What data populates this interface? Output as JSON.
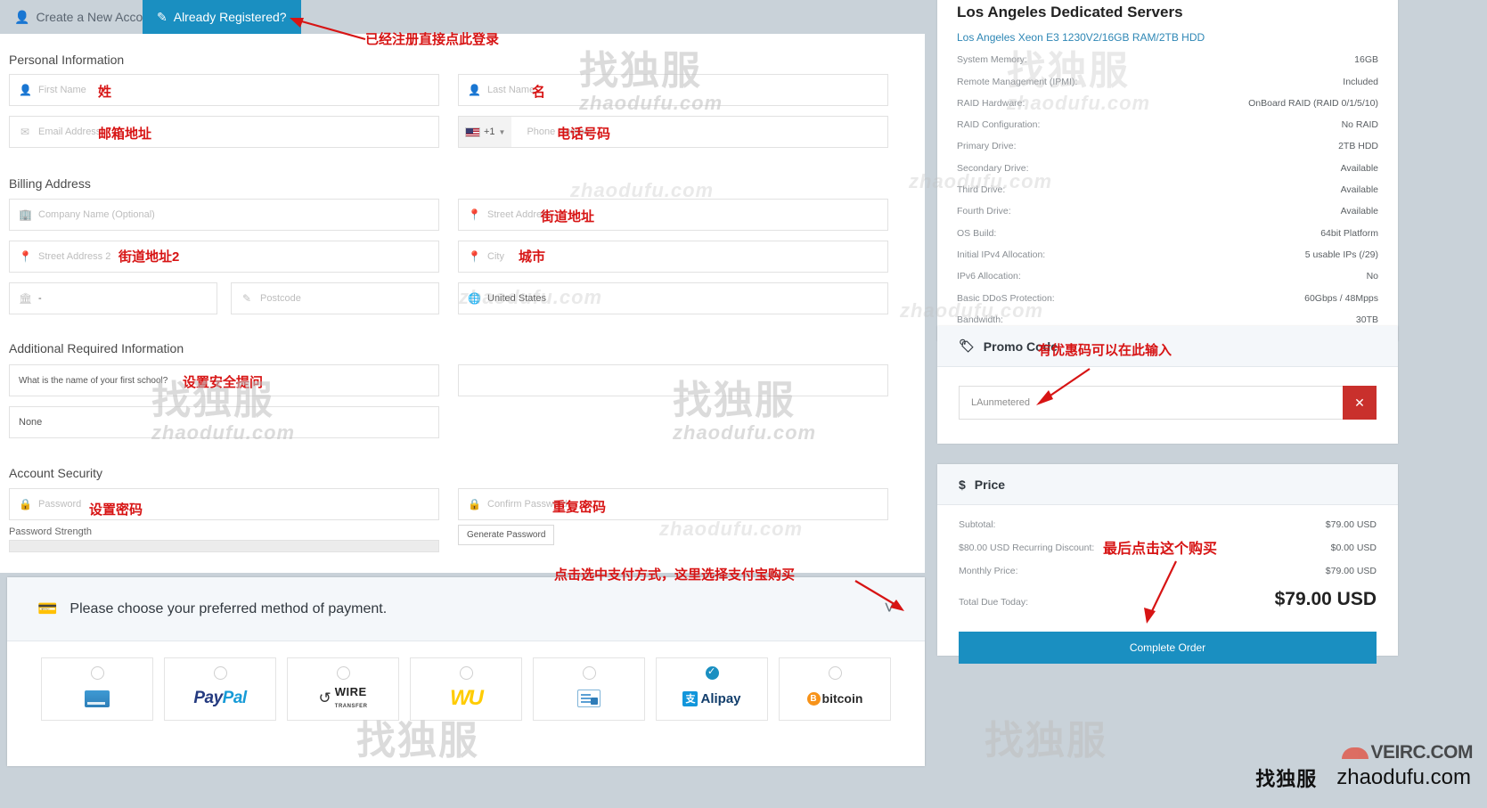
{
  "tabs": {
    "create_account": "Create a New Account",
    "already_registered": "Already Registered?"
  },
  "annotations": {
    "login": "已经注册直接点此登录",
    "first_name": "姓",
    "last_name": "名",
    "email": "邮箱地址",
    "phone": "电话号码",
    "street": "街道地址",
    "street2": "街道地址2",
    "city": "城市",
    "security_question": "设置安全提问",
    "password": "设置密码",
    "confirm_password": "重复密码",
    "payment": "点击选中支付方式，这里选择支付宝购买",
    "promo": "有优惠码可以在此输入",
    "complete": "最后点击这个购买"
  },
  "sections": {
    "personal": "Personal Information",
    "billing": "Billing Address",
    "additional": "Additional Required Information",
    "security": "Account Security"
  },
  "fields": {
    "first_name": {
      "placeholder": "First Name",
      "icon": "user-icon"
    },
    "last_name": {
      "placeholder": "Last Name",
      "icon": "user-icon"
    },
    "email": {
      "placeholder": "Email Address",
      "icon": "envelope-icon"
    },
    "phone": {
      "placeholder": "Phone Number",
      "prefix": "+1",
      "icon": "flag-icon"
    },
    "company": {
      "placeholder": "Company Name (Optional)",
      "icon": "building-icon"
    },
    "street": {
      "placeholder": "Street Address",
      "icon": "map-pin-icon"
    },
    "street2": {
      "placeholder": "Street Address 2",
      "icon": "map-pin-icon"
    },
    "city": {
      "placeholder": "City",
      "icon": "map-pin-icon"
    },
    "state": {
      "value": "-",
      "icon": "bank-icon"
    },
    "postcode": {
      "placeholder": "Postcode",
      "icon": "pencil-icon"
    },
    "country": {
      "value": "United States",
      "icon": "globe-icon"
    },
    "sec_question": {
      "value": "What is the name of your first school?"
    },
    "sec_answer": {
      "value": ""
    },
    "none_select": {
      "value": "None"
    },
    "password": {
      "placeholder": "Password",
      "icon": "lock-icon"
    },
    "confirm_password": {
      "placeholder": "Confirm Password",
      "icon": "lock-icon"
    },
    "password_strength_label": "Password Strength",
    "generate_password": "Generate Password"
  },
  "payment": {
    "heading": "Please choose your preferred method of payment.",
    "methods": [
      {
        "name": "credit-card",
        "label": "",
        "selected": false
      },
      {
        "name": "paypal",
        "label": "PayPal",
        "selected": false
      },
      {
        "name": "wire-transfer",
        "label": "WIRE TRANSFER",
        "selected": false
      },
      {
        "name": "western-union",
        "label": "WU",
        "selected": false
      },
      {
        "name": "bank-transfer",
        "label": "",
        "selected": false
      },
      {
        "name": "alipay",
        "label": "Alipay",
        "selected": true
      },
      {
        "name": "bitcoin",
        "label": "bitcoin",
        "selected": false
      }
    ]
  },
  "summary": {
    "title": "Los Angeles Dedicated Servers",
    "subtitle": "Los Angeles Xeon E3 1230V2/16GB RAM/2TB HDD",
    "specs": [
      {
        "label": "System Memory:",
        "value": "16GB"
      },
      {
        "label": "Remote Management (IPMI):",
        "value": "Included"
      },
      {
        "label": "RAID Hardware:",
        "value": "OnBoard RAID (RAID 0/1/5/10)"
      },
      {
        "label": "RAID Configuration:",
        "value": "No RAID"
      },
      {
        "label": "Primary Drive:",
        "value": "2TB HDD"
      },
      {
        "label": "Secondary Drive:",
        "value": "Available"
      },
      {
        "label": "Third Drive:",
        "value": "Available"
      },
      {
        "label": "Fourth Drive:",
        "value": "Available"
      },
      {
        "label": "OS Build:",
        "value": "64bit Platform"
      },
      {
        "label": "Initial IPv4 Allocation:",
        "value": "5 usable IPs (/29)"
      },
      {
        "label": "IPv6 Allocation:",
        "value": "No"
      },
      {
        "label": "Basic DDoS Protection:",
        "value": "60Gbps / 48Mpps"
      },
      {
        "label": "Bandwidth:",
        "value": "30TB"
      }
    ]
  },
  "promo": {
    "title": "Promo Code",
    "value": "LAunmetered",
    "clear_icon": "✕"
  },
  "price": {
    "title": "Price",
    "currency_icon": "$",
    "rows": [
      {
        "label": "Subtotal:",
        "value": "$79.00 USD"
      },
      {
        "label": "$80.00 USD Recurring Discount:",
        "value": "$0.00 USD"
      },
      {
        "label": "Monthly Price:",
        "value": "$79.00 USD"
      }
    ],
    "total_label": "Total Due Today:",
    "total_value": "$79.00 USD",
    "complete_order": "Complete Order"
  },
  "brand": {
    "top": "VEIRC.COM",
    "cn": "找独服",
    "en": "zhaodufu.com"
  },
  "watermark": {
    "cn": "找独服",
    "en": "zhaodufu.com"
  },
  "colors": {
    "accent": "#1a8fc1",
    "danger": "#c9302c",
    "annotation": "#d71414"
  }
}
